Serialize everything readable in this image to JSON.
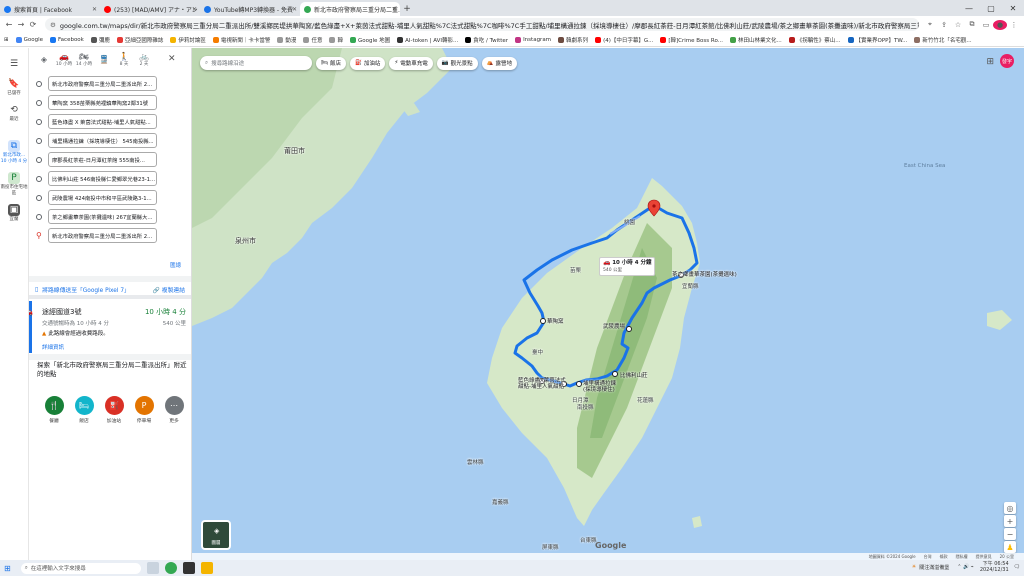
{
  "tabs": [
    {
      "label": "搜索首頁 | Facebook",
      "color": "#1877f2",
      "active": false
    },
    {
      "label": "(253) [MAD/AMV] アナ・アン",
      "color": "#ff0000",
      "active": false
    },
    {
      "label": "YouTube轉MP3轉換器 - 免費",
      "color": "#1a73e8",
      "active": false
    },
    {
      "label": "新北市政府警察局三重分局二重...",
      "color": "#34a853",
      "active": true
    }
  ],
  "window_controls": [
    "—",
    "▢",
    "✕"
  ],
  "address": {
    "url": "google.com.tw/maps/dir/新北市政府警察局三重分局二重派出所/雙溪鄉民堤拱華陶窯/藍色綠盡+X+萊茵法式甜點-埔里人氣甜點%7C法式甜點%7C咖啡%7C手工甜點/埔里構通拉鍊（採境導棲住）/摩郡長紅茶莊-日月潭紅茶館/比佛利山莊/武陵農場/茶之鄉畫華茶園(茶攤遺味)/新北市政府警察局三重分局二重派出所/@24.483982,..."
  },
  "bookmarks": [
    "Google",
    "Facebook",
    "彌鹿",
    "亞細亞國際雜誌",
    "伊莉討論區",
    "電視新聞｜卡卡當警",
    "動漫",
    "任意",
    "韓",
    "Google 地圖",
    "AI-token | AVI轉影...",
    "貪吃 / Twitter",
    "Instagram",
    "韓劇系列",
    "(4)【中日字幕】G...",
    "[韓]Crime Boss Ro...",
    "林田山林業文化...",
    "《拐騙性》蔡山...",
    "【實業界OPP】TW...",
    "新竹竹北「名宅觀..."
  ],
  "rail": [
    {
      "icon": "☰",
      "label": ""
    },
    {
      "icon": "🔖",
      "label": "已儲存"
    },
    {
      "icon": "⟲",
      "label": "最近"
    },
    {
      "icon": "⧉",
      "label": "新北市政... 10 小時 4 分"
    },
    {
      "icon": "P",
      "label": "南投市住宅地區"
    },
    {
      "icon": "▣",
      "label": "宜蘭"
    }
  ],
  "modes": [
    {
      "glyph": "◈",
      "label": ""
    },
    {
      "glyph": "🚗",
      "label": "10 小時"
    },
    {
      "glyph": "🏍",
      "label": "14 小時"
    },
    {
      "glyph": "🚆",
      "label": ""
    },
    {
      "glyph": "🚶",
      "label": "8 天"
    },
    {
      "glyph": "🚲",
      "label": "2 天"
    }
  ],
  "stops": [
    "新北市政府警察局三重分局二重派出所 2...",
    "華陶窯 358苗栗縣苑裡鎮華陶窯2鄰31號",
    "藍色綠盡 X 萊茵法式甜點-埔里人氣甜點...",
    "埔里構通拉鍊（採境導棲住） 545南投縣...",
    "摩郡長紅茶莊-日月潭紅茶館 555南投...",
    "比佛利山莊 546南投縣仁愛鄉翠光巷23-1...",
    "武陵農場 424南投中市和平區武陵路3-1...",
    "茶之鄉畫華茶園(茶攤遺味) 267宜蘭縣大...",
    "新北市政府警察局三重分局二重派出所 2..."
  ],
  "add_stop": "匯總",
  "send_phone": "將路線傳送至「Google Pixel 7」",
  "copy_link": "複製連結",
  "route": {
    "via": "途經國道3號",
    "time": "10 小時 4 分",
    "traffic": "交通號暢時為 10 小時 4 分",
    "distance": "540 公里",
    "warning": "此路線會經過收費路段。",
    "details": "詳細資訊"
  },
  "nearby_title": "探索「新北市政府警察局三重分局二重派出所」附近的地點",
  "categories": [
    {
      "label": "餐廳",
      "icon": "🍴",
      "color": "#188038"
    },
    {
      "label": "飯店",
      "icon": "🛏",
      "color": "#12b5cb"
    },
    {
      "label": "加油站",
      "icon": "⛽",
      "color": "#d93025"
    },
    {
      "label": "停車場",
      "icon": "P",
      "color": "#e37400"
    },
    {
      "label": "更多",
      "icon": "⋯",
      "color": "#70757a"
    }
  ],
  "map_search_placeholder": "搜尋路線沿途",
  "chips": [
    {
      "icon": "🛏",
      "label": "飯店"
    },
    {
      "icon": "⛽",
      "label": "加油站"
    },
    {
      "icon": "⚡",
      "label": "電動車充電"
    },
    {
      "icon": "📷",
      "label": "觀光景點"
    },
    {
      "icon": "⛺",
      "label": "露營地"
    }
  ],
  "avatar_text": "發宇",
  "map_labels": {
    "cities": [
      "泉州市",
      "莆田市"
    ],
    "sea": [
      "East China Sea"
    ],
    "places": [
      "桃園",
      "苗栗",
      "臺中",
      "華陶窯",
      "宜蘭縣",
      "武陵農場",
      "比佛利山莊",
      "南投縣",
      "花蓮縣",
      "雲林縣",
      "嘉義縣",
      "台東縣",
      "屏東縣"
    ],
    "pois": [
      "茶之鄉畫華茶園(茶攤遺味)",
      "藍色綠盡X萊茵法式甜點-埔里人氣甜點",
      "埔里構通拉鍊(採境導棲住)",
      "日月潭"
    ]
  },
  "route_time_box": {
    "time": "10 小時 4 分鐘",
    "distance": "540 公里"
  },
  "layers_label": "圖層",
  "google_logo": "Google",
  "attribution": [
    "地圖資料 ©2024 Google",
    "台灣",
    "條款",
    "隱私權",
    "提供意見",
    "20 公里"
  ],
  "taskbar": {
    "search_placeholder": "在這裡輸入文字來搜尋",
    "weather": "關注滿溢備堡",
    "time": "下午 06:54",
    "date": "2024/12/31"
  }
}
